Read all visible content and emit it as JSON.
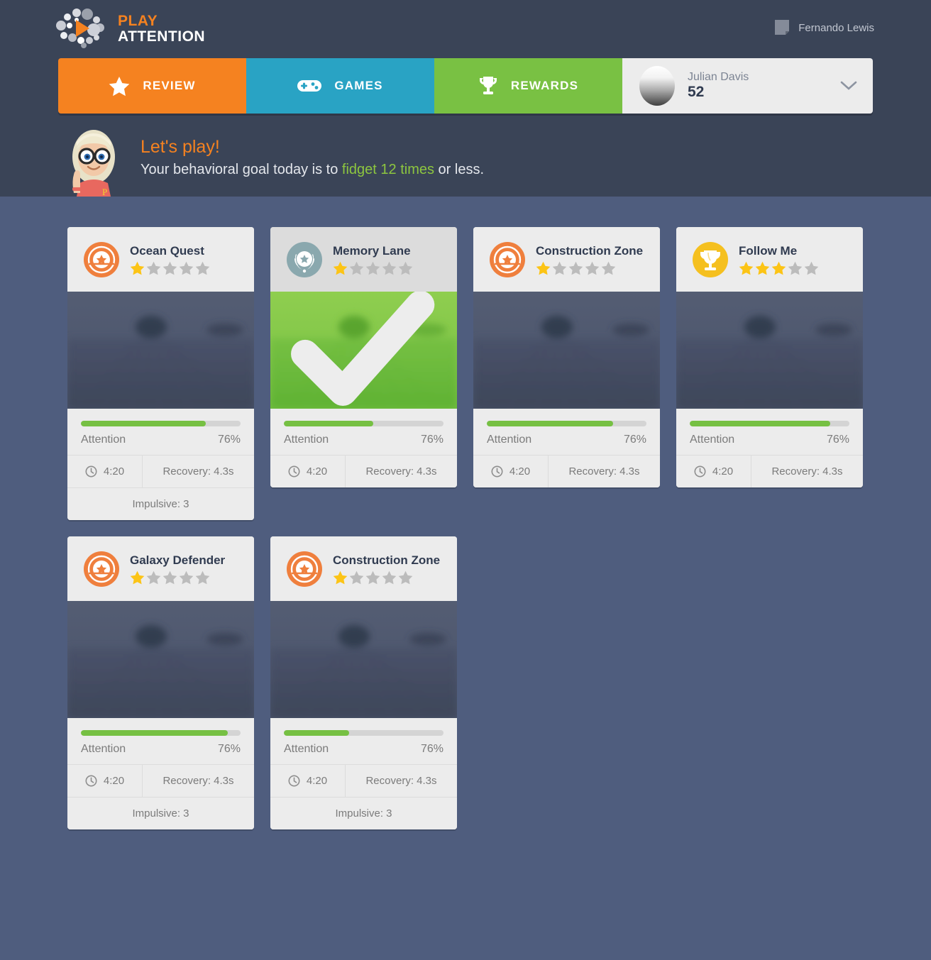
{
  "brand": {
    "line1": "PLAY",
    "line2": "ATTENTION",
    "logo_icon": "play-attention-logo",
    "play_color": "#f58220"
  },
  "account": {
    "icon": "note-page-icon",
    "name": "Fernando Lewis"
  },
  "nav": {
    "tabs": [
      {
        "label": "REVIEW",
        "icon": "star-icon",
        "color": "#f58220",
        "active": true
      },
      {
        "label": "GAMES",
        "icon": "gamepad-icon",
        "color": "#29a3c4",
        "active": false
      },
      {
        "label": "REWARDS",
        "icon": "trophy-icon",
        "color": "#79c143",
        "active": false
      }
    ],
    "user": {
      "name": "Julian Davis",
      "score": "52",
      "avatar_icon": "user-avatar",
      "chevron_icon": "chevron-down-icon"
    }
  },
  "greeting": {
    "coach_icon": "coach-avatar",
    "title": "Let's play!",
    "sub_before": "Your behavioral goal today is to ",
    "sub_highlight": "fidget 12 times",
    "sub_after": " or less.",
    "highlight_color": "#8dc63f"
  },
  "labels": {
    "attention": "Attention",
    "recovery_prefix": "Recovery: ",
    "impulsive_prefix": "Impulsive: ",
    "clock_icon": "clock-icon",
    "check_icon": "check-icon"
  },
  "cards": [
    {
      "title": "Ocean Quest",
      "badge_icon": "shield-star-badge",
      "badge_color": "#ef7f3d",
      "stars_filled": 1,
      "stars_total": 5,
      "selected": false,
      "attention_label": "Attention",
      "attention_value": "76%",
      "attention_percent": 78,
      "time": "4:20",
      "recovery": "Recovery: 4.3s",
      "impulsive": "Impulsive: 3",
      "has_impulsive": true
    },
    {
      "title": "Memory Lane",
      "badge_icon": "laurel-star-badge",
      "badge_color": "#8aa8ae",
      "stars_filled": 1,
      "stars_total": 5,
      "selected": true,
      "attention_label": "Attention",
      "attention_value": "76%",
      "attention_percent": 56,
      "time": "4:20",
      "recovery": "Recovery: 4.3s",
      "impulsive": "",
      "has_impulsive": false
    },
    {
      "title": "Construction Zone",
      "badge_icon": "shield-star-badge",
      "badge_color": "#ef7f3d",
      "stars_filled": 1,
      "stars_total": 5,
      "selected": false,
      "attention_label": "Attention",
      "attention_value": "76%",
      "attention_percent": 79,
      "time": "4:20",
      "recovery": "Recovery: 4.3s",
      "impulsive": "",
      "has_impulsive": false
    },
    {
      "title": "Follow Me",
      "badge_icon": "trophy-badge",
      "badge_color": "#f5c01f",
      "stars_filled": 3,
      "stars_total": 5,
      "selected": false,
      "attention_label": "Attention",
      "attention_value": "76%",
      "attention_percent": 88,
      "time": "4:20",
      "recovery": "Recovery: 4.3s",
      "impulsive": "",
      "has_impulsive": false
    },
    {
      "title": "Galaxy Defender",
      "badge_icon": "shield-star-badge",
      "badge_color": "#ef7f3d",
      "stars_filled": 1,
      "stars_total": 5,
      "selected": false,
      "attention_label": "Attention",
      "attention_value": "76%",
      "attention_percent": 92,
      "time": "4:20",
      "recovery": "Recovery: 4.3s",
      "impulsive": "Impulsive: 3",
      "has_impulsive": true
    },
    {
      "title": "Construction Zone",
      "badge_icon": "shield-star-badge",
      "badge_color": "#ef7f3d",
      "stars_filled": 1,
      "stars_total": 5,
      "selected": false,
      "attention_label": "Attention",
      "attention_value": "76%",
      "attention_percent": 41,
      "time": "4:20",
      "recovery": "Recovery: 4.3s",
      "impulsive": "Impulsive: 3",
      "has_impulsive": true
    }
  ]
}
